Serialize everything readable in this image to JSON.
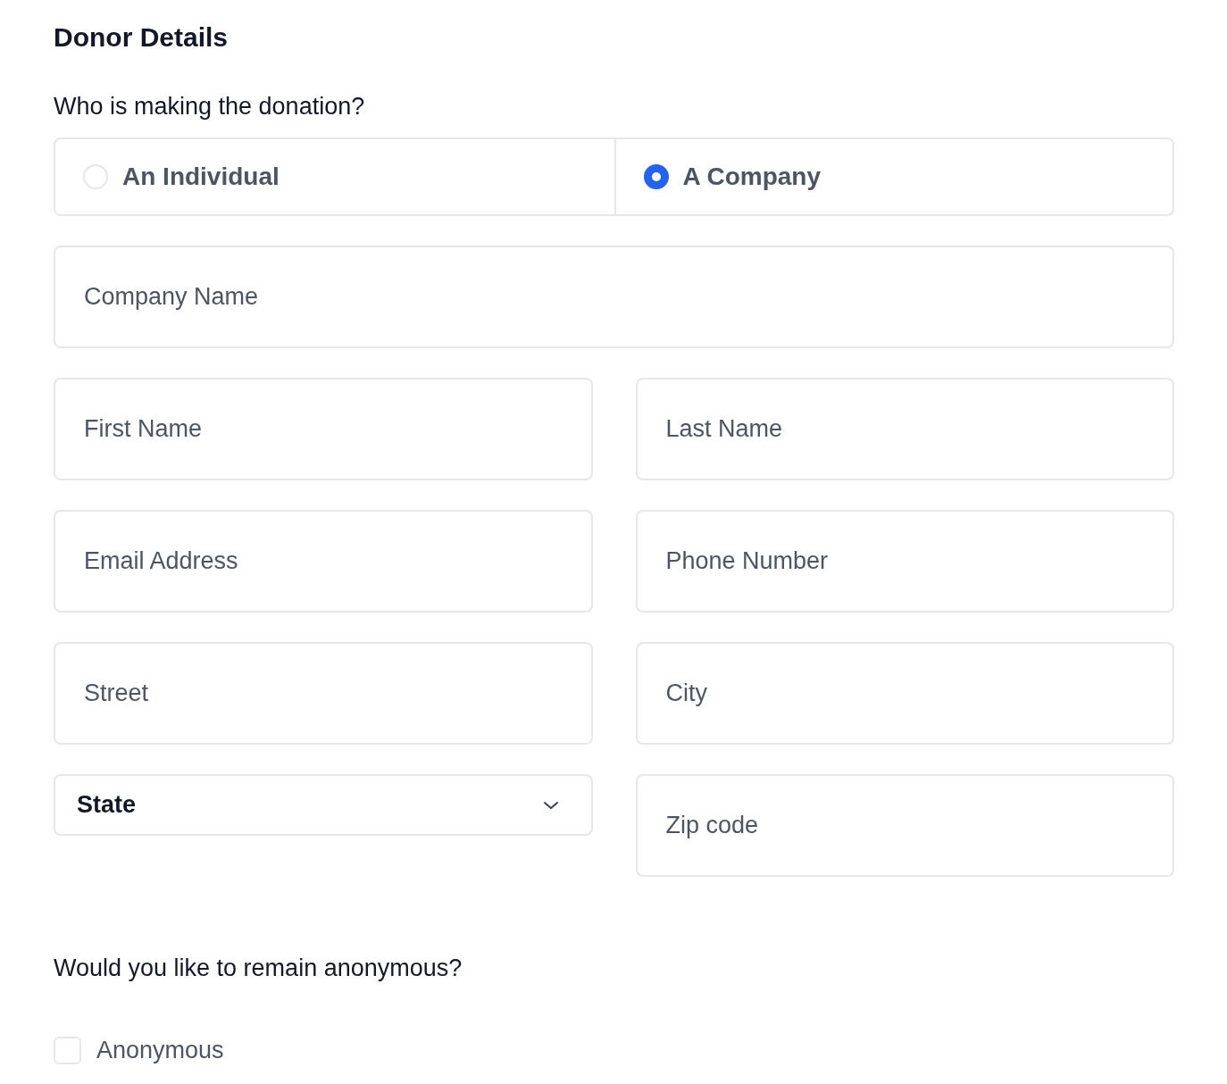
{
  "title": "Donor Details",
  "donor_type": {
    "question": "Who is making the donation?",
    "options": [
      {
        "label": "An Individual",
        "selected": false
      },
      {
        "label": "A Company",
        "selected": true
      }
    ]
  },
  "company_name": {
    "placeholder": "Company Name"
  },
  "field_rows": [
    [
      {
        "kind": "text",
        "placeholder": "First Name"
      },
      {
        "kind": "text",
        "placeholder": "Last Name"
      }
    ],
    [
      {
        "kind": "text",
        "placeholder": "Email Address"
      },
      {
        "kind": "text",
        "placeholder": "Phone Number"
      }
    ],
    [
      {
        "kind": "text",
        "placeholder": "Street"
      },
      {
        "kind": "text",
        "placeholder": "City"
      }
    ],
    [
      {
        "kind": "select",
        "label": "State"
      },
      {
        "kind": "text",
        "placeholder": "Zip code"
      }
    ]
  ],
  "anonymous": {
    "question": "Would you like to remain anonymous?",
    "checkbox": {
      "label": "Anonymous",
      "checked": false
    }
  }
}
